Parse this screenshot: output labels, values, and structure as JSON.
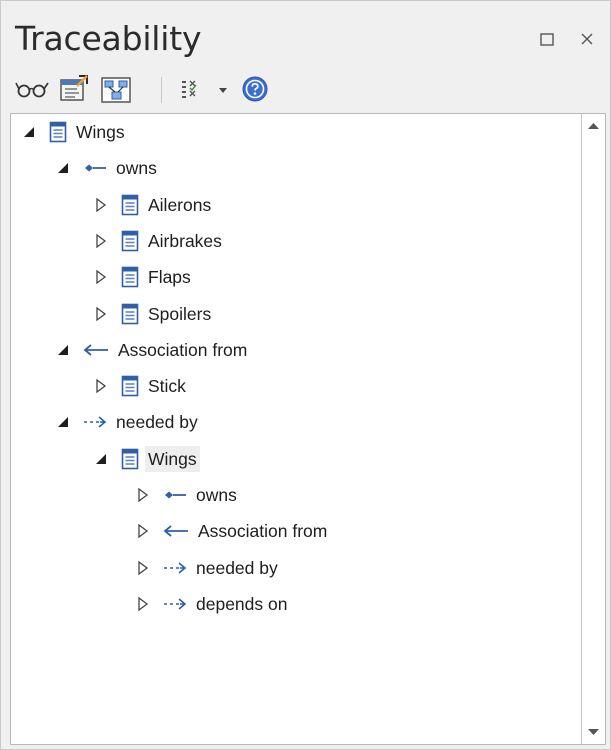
{
  "window": {
    "title": "Traceability",
    "restore_icon": "restore-window-icon",
    "close_icon": "close-icon"
  },
  "toolbar": {
    "buttons": [
      {
        "icon": "glasses-icon"
      },
      {
        "icon": "locate-in-browser-icon"
      },
      {
        "icon": "diagram-icon"
      },
      {
        "icon": "filter-list-icon"
      },
      {
        "icon": "dropdown-arrow-icon"
      },
      {
        "icon": "help-icon"
      }
    ]
  },
  "tree": {
    "nodes": [
      {
        "label": "Wings",
        "icon": "requirement-icon",
        "state": "expanded"
      },
      {
        "label": "owns",
        "icon": "composition-connector-icon",
        "state": "expanded"
      },
      {
        "label": "Ailerons",
        "icon": "requirement-icon",
        "state": "collapsed"
      },
      {
        "label": "Airbrakes",
        "icon": "requirement-icon",
        "state": "collapsed"
      },
      {
        "label": "Flaps",
        "icon": "requirement-icon",
        "state": "collapsed"
      },
      {
        "label": "Spoilers",
        "icon": "requirement-icon",
        "state": "collapsed"
      },
      {
        "label": "Association from",
        "icon": "association-arrow-icon",
        "state": "expanded"
      },
      {
        "label": "Stick",
        "icon": "requirement-icon",
        "state": "collapsed"
      },
      {
        "label": "needed by",
        "icon": "dependency-arrow-icon",
        "state": "expanded"
      },
      {
        "label": "Wings",
        "icon": "requirement-icon",
        "state": "expanded",
        "selected": true
      },
      {
        "label": "owns",
        "icon": "composition-connector-icon",
        "state": "collapsed"
      },
      {
        "label": "Association from",
        "icon": "association-arrow-icon",
        "state": "collapsed"
      },
      {
        "label": "needed by",
        "icon": "dependency-arrow-icon",
        "state": "collapsed"
      },
      {
        "label": "depends on",
        "icon": "dependency-arrow-icon",
        "state": "collapsed"
      }
    ]
  },
  "colors": {
    "accent": "#2f5fa8",
    "panel_bg": "#f0f0f0",
    "tree_bg": "#ffffff",
    "selection_bg": "#eeeeee"
  }
}
